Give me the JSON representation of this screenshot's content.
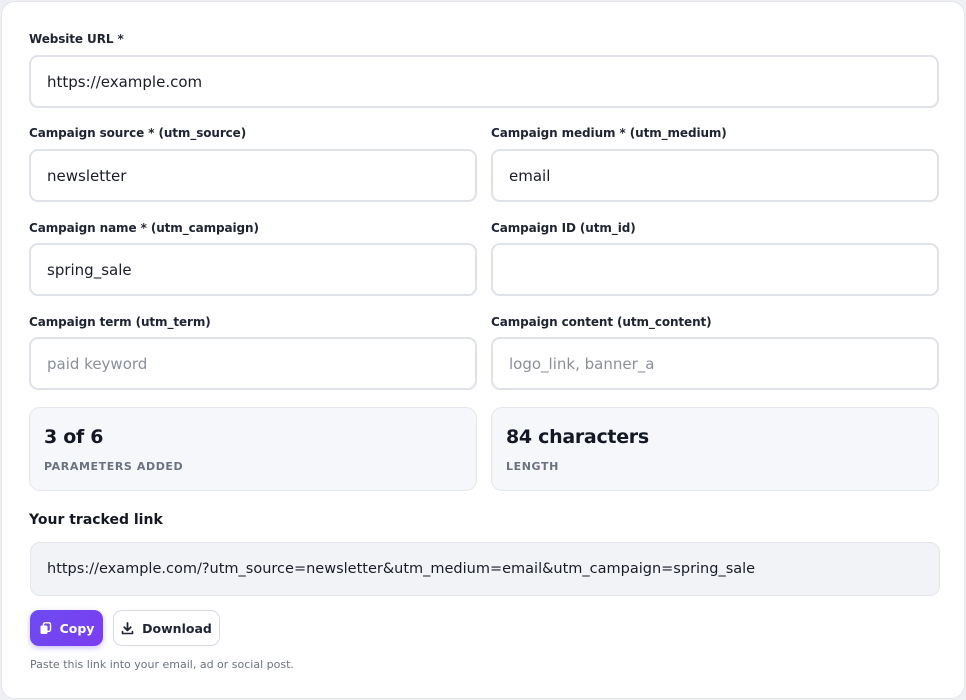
{
  "form": {
    "website_url": {
      "label": "Website URL *",
      "value": "https://example.com",
      "placeholder": ""
    },
    "source": {
      "label": "Campaign source * (utm_source)",
      "value": "newsletter",
      "placeholder": ""
    },
    "medium": {
      "label": "Campaign medium * (utm_medium)",
      "value": "email",
      "placeholder": ""
    },
    "campaign_name": {
      "label": "Campaign name * (utm_campaign)",
      "value": "spring_sale",
      "placeholder": ""
    },
    "campaign_id": {
      "label": "Campaign ID (utm_id)",
      "value": "",
      "placeholder": ""
    },
    "term": {
      "label": "Campaign term (utm_term)",
      "value": "",
      "placeholder": "paid keyword"
    },
    "content": {
      "label": "Campaign content (utm_content)",
      "value": "",
      "placeholder": "logo_link, banner_a"
    }
  },
  "stats": {
    "parameters": {
      "value": "3 of 6",
      "caption": "Parameters added"
    },
    "length": {
      "value": "84 characters",
      "caption": "Length"
    }
  },
  "result": {
    "title": "Your tracked link",
    "link": "https://example.com/?utm_source=newsletter&utm_medium=email&utm_campaign=spring_sale"
  },
  "actions": {
    "copy_label": "Copy",
    "copy_icon": "copy-icon",
    "download_label": "Download",
    "download_icon": "download-icon"
  },
  "hint": "Paste this link into your email, ad or social post.",
  "colors": {
    "accent": "#6d4bf2",
    "text": "#1a1d29",
    "muted": "#6b7280",
    "border": "#dfe2e8"
  }
}
